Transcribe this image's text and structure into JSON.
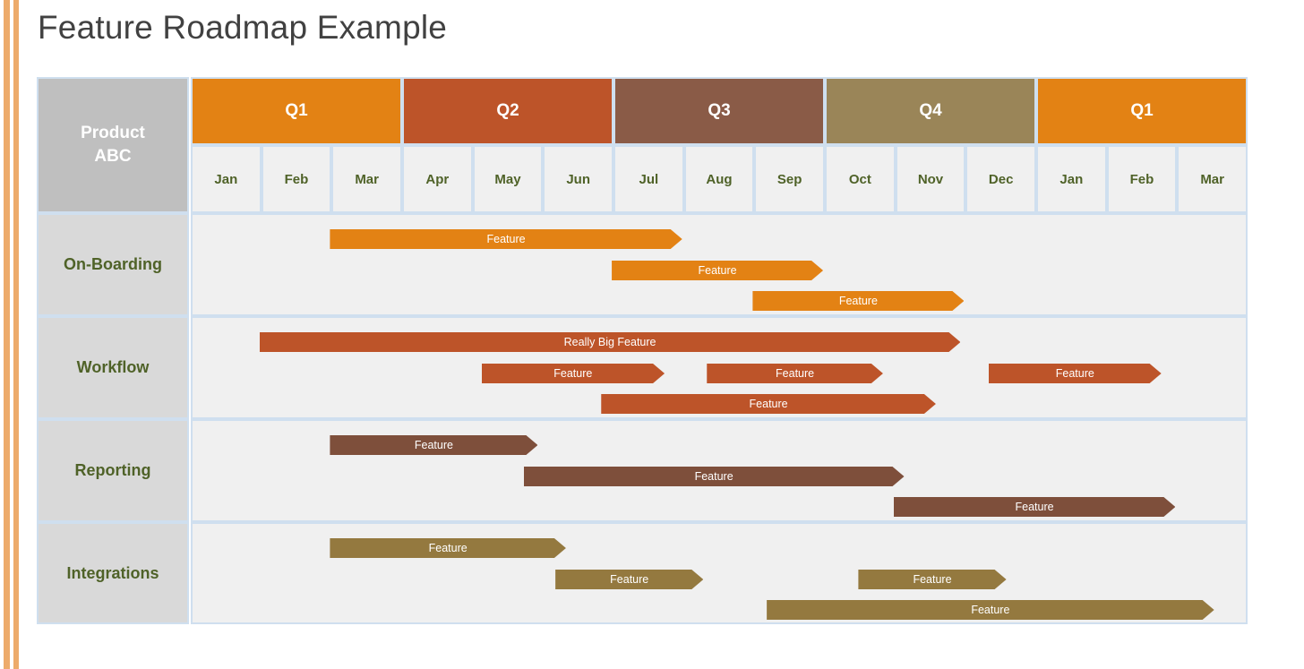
{
  "title": "Feature Roadmap Example",
  "product": {
    "line1": "Product",
    "line2": "ABC",
    "label": "Product ABC"
  },
  "colors": {
    "stripe": "#EDAB6B",
    "q1": "#E38214",
    "q2": "#BD5429",
    "q3": "#8A5B47",
    "q4": "#9A8558",
    "q5": "#E38214",
    "onboarding_bar": "#E38214",
    "workflow_bar": "#BD5429",
    "reporting_bar": "#7E4F3B",
    "integrations_bar": "#94793F",
    "grid_border": "#CFDFEF",
    "lane_label_bg": "#D9D9D9",
    "lane_track_bg": "#F0F0F0",
    "product_bg": "#BFBFBF",
    "label_text": "#4F6228",
    "title_text": "#414141"
  },
  "quarters": [
    {
      "label": "Q1",
      "color": "#E38214",
      "span": 3
    },
    {
      "label": "Q2",
      "color": "#BD5429",
      "span": 3
    },
    {
      "label": "Q3",
      "color": "#8A5B47",
      "span": 3
    },
    {
      "label": "Q4",
      "color": "#9A8558",
      "span": 3
    },
    {
      "label": "Q1",
      "color": "#E38214",
      "span": 3
    }
  ],
  "months": [
    "Jan",
    "Feb",
    "Mar",
    "Apr",
    "May",
    "Jun",
    "Jul",
    "Aug",
    "Sep",
    "Oct",
    "Nov",
    "Dec",
    "Jan",
    "Feb",
    "Mar"
  ],
  "lanes": [
    {
      "name": "On-Boarding",
      "color": "#E38214",
      "bars": [
        {
          "label": "Feature",
          "start_month": 1.95,
          "end_month": 6.95,
          "row": 0
        },
        {
          "label": "Feature",
          "start_month": 5.95,
          "end_month": 8.95,
          "row": 1
        },
        {
          "label": "Feature",
          "start_month": 7.95,
          "end_month": 10.95,
          "row": 2
        }
      ]
    },
    {
      "name": "Workflow",
      "color": "#BD5429",
      "bars": [
        {
          "label": "Really Big Feature",
          "start_month": 0.95,
          "end_month": 10.9,
          "row": 0
        },
        {
          "label": "Feature",
          "start_month": 4.1,
          "end_month": 6.7,
          "row": 1
        },
        {
          "label": "Feature",
          "start_month": 7.3,
          "end_month": 9.8,
          "row": 1
        },
        {
          "label": "Feature",
          "start_month": 11.3,
          "end_month": 13.75,
          "row": 1
        },
        {
          "label": "Feature",
          "start_month": 5.8,
          "end_month": 10.55,
          "row": 2
        }
      ]
    },
    {
      "name": "Reporting",
      "color": "#7E4F3B",
      "bars": [
        {
          "label": "Feature",
          "start_month": 1.95,
          "end_month": 4.9,
          "row": 0
        },
        {
          "label": "Feature",
          "start_month": 4.7,
          "end_month": 10.1,
          "row": 1
        },
        {
          "label": "Feature",
          "start_month": 9.95,
          "end_month": 13.95,
          "row": 2
        }
      ]
    },
    {
      "name": "Integrations",
      "color": "#94793F",
      "bars": [
        {
          "label": "Feature",
          "start_month": 1.95,
          "end_month": 5.3,
          "row": 0
        },
        {
          "label": "Feature",
          "start_month": 5.15,
          "end_month": 7.25,
          "row": 1
        },
        {
          "label": "Feature",
          "start_month": 9.45,
          "end_month": 11.55,
          "row": 1
        },
        {
          "label": "Feature",
          "start_month": 8.15,
          "end_month": 14.5,
          "row": 2
        }
      ]
    }
  ]
}
